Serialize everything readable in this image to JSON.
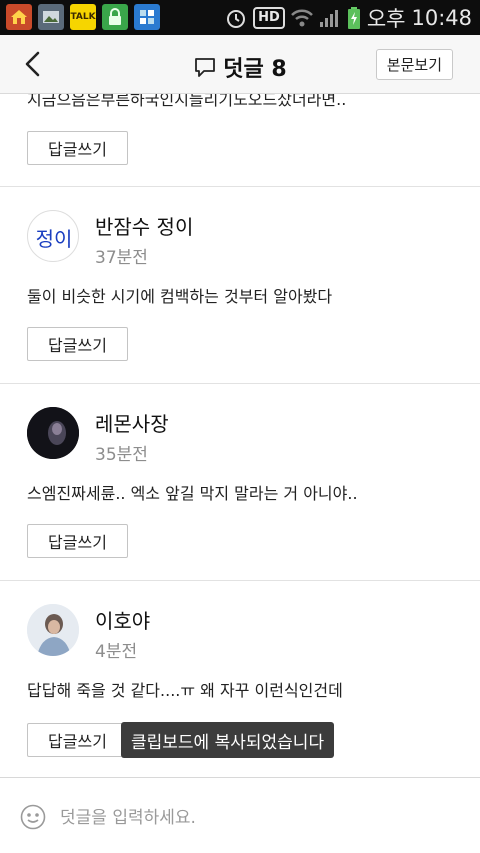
{
  "status_bar": {
    "time_period": "오후",
    "clock": "10:48",
    "network_badge": "HD",
    "notification_icons": [
      "home-icon",
      "gallery-icon",
      "talk-icon",
      "lock-icon",
      "app-icon"
    ],
    "talk_badge": "TALK"
  },
  "header": {
    "title": "덧글 8",
    "original_button": "본문보기"
  },
  "reply_label": "답글쓰기",
  "partial_comment": {
    "text": "지금으음은부른하국인시들리기도오드잤더라면.."
  },
  "comments": [
    {
      "author": "반잠수 정이",
      "time": "37분전",
      "text": "둘이 비슷한 시기에 컴백하는 것부터 알아봤다",
      "avatar_text": "정이"
    },
    {
      "author": "레몬사장",
      "time": "35분전",
      "text": "스엠진짜세륜.. 엑소 앞길 막지 말라는 거 아니야.."
    },
    {
      "author": "이호야",
      "time": "4분전",
      "text": "답답해 죽을 것 같다....ㅠ 왜 자꾸 이런식인건데"
    }
  ],
  "toast": "클립보드에 복사되었습니다",
  "input": {
    "placeholder": "덧글을 입력하세요."
  },
  "colors": {
    "status_bar": "#0d0d0d",
    "header_bg": "#f7f7f7",
    "toast_bg": "#3c3c3c",
    "meta_text": "#8d8d8d"
  }
}
